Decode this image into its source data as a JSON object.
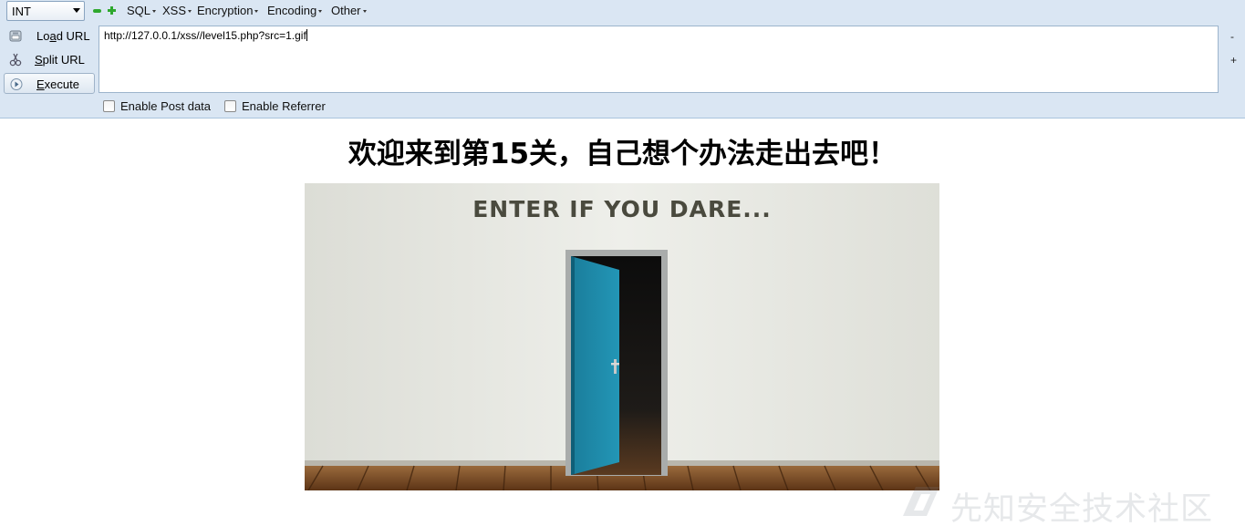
{
  "hackbar": {
    "select_value": "INT",
    "menus": {
      "sql": "SQL",
      "xss": "XSS",
      "encryption": "Encryption",
      "encoding": "Encoding",
      "other": "Other"
    },
    "buttons": {
      "load_prefix": "Lo",
      "load_u": "a",
      "load_suffix": "d URL",
      "split_u": "S",
      "split_suffix": "plit URL",
      "exec_u": "E",
      "exec_suffix": "xecute"
    },
    "url_value": "http://127.0.0.1/xss//level15.php?src=1.gif",
    "side_minus": "-",
    "side_plus": "+",
    "enable_post": "Enable Post data",
    "enable_referrer": "Enable Referrer"
  },
  "page": {
    "heading": "欢迎来到第15关，自己想个办法走出去吧！",
    "image_text": "ENTER IF YOU DARE..."
  },
  "watermark": {
    "text": "先知安全技术社区"
  },
  "colors": {
    "toolbar_bg": "#dae6f3",
    "door": "#1e8aa8",
    "wall": "#e8e9e4",
    "floor": "#7a4a22"
  }
}
